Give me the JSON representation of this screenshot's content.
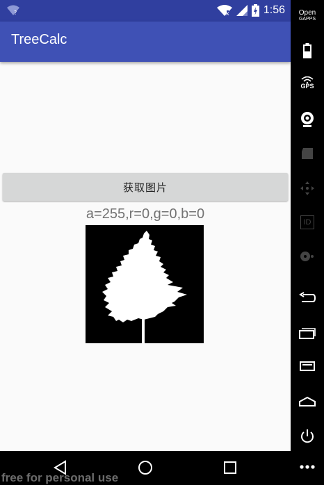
{
  "status_bar": {
    "time": "1:56",
    "colors": {
      "bg": "#303F9F"
    },
    "icons": [
      "wifi-question-icon",
      "wifi-icon",
      "signal-icon",
      "battery-charging-icon"
    ]
  },
  "app_bar": {
    "title": "TreeCalc",
    "colors": {
      "bg": "#3F51B5"
    }
  },
  "main": {
    "button_label": "获取图片",
    "rgba_text": "a=255,r=0,g=0,b=0",
    "image": {
      "icon": "tree-silhouette-icon"
    }
  },
  "nav_bar": {
    "icons": [
      "back-triangle-icon",
      "home-circle-icon",
      "recents-square-icon"
    ]
  },
  "side_panel": {
    "open_gapps_line1": "Open",
    "open_gapps_line2": "GAPPS",
    "gps_label": "GPS",
    "id_label": "ID",
    "icons": [
      "battery-icon",
      "gps-icon",
      "webcam-icon",
      "clapperboard-icon",
      "move-icon",
      "id-icon",
      "disk-icon",
      "back-icon",
      "recents-icon",
      "menu-icon",
      "home-icon",
      "power-icon",
      "more-icon"
    ]
  },
  "watermark": "free for personal use"
}
